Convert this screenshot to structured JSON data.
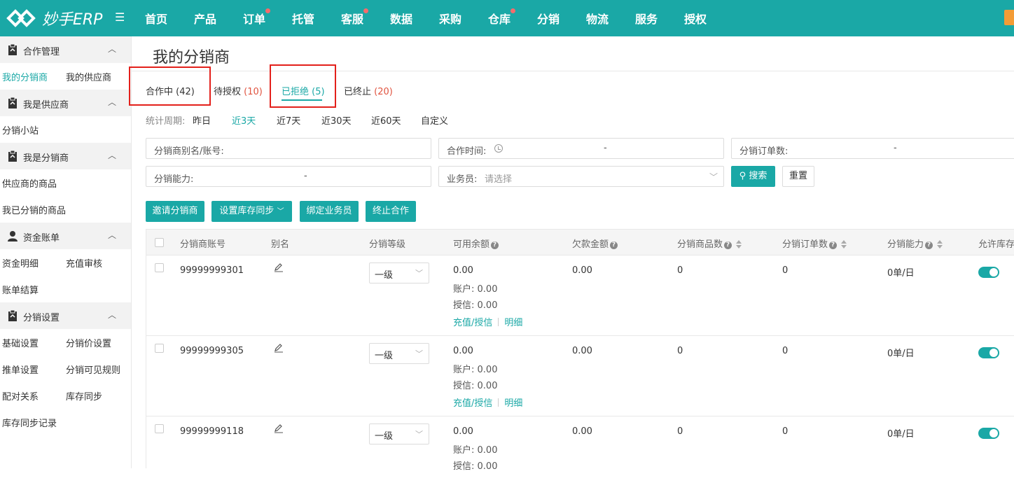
{
  "app": {
    "logo_text": "妙手ERP"
  },
  "nav": [
    "首页",
    "产品",
    "订单",
    "托管",
    "客服",
    "数据",
    "采购",
    "仓库",
    "分销",
    "物流",
    "服务",
    "授权"
  ],
  "sidebar": {
    "groups": [
      "合作管理",
      "我是供应商",
      "我是分销商",
      "资金账单",
      "分销设置"
    ],
    "links": {
      "my_distributors": "我的分销商",
      "my_suppliers": "我的供应商",
      "distribution_site": "分销小站",
      "supplier_products": "供应商的商品",
      "my_distributed_products": "我已分销的商品",
      "fund_details": "资金明细",
      "recharge_review": "充值审核",
      "bill_settlement": "账单结算",
      "basic_settings": "基础设置",
      "price_settings": "分销价设置",
      "push_settings": "推单设置",
      "visibility_rules": "分销可见规则",
      "pairing": "配对关系",
      "stock_sync": "库存同步",
      "stock_sync_log": "库存同步记录"
    }
  },
  "page": {
    "title": "我的分销商"
  },
  "tabs": [
    {
      "label": "合作中",
      "count": "(42)"
    },
    {
      "label": "待授权",
      "count": "(10)"
    },
    {
      "label": "已拒绝",
      "count": "(5)"
    },
    {
      "label": "已终止",
      "count": "(20)"
    }
  ],
  "period": {
    "label": "统计周期:",
    "options": [
      "昨日",
      "近3天",
      "近7天",
      "近30天",
      "近60天",
      "自定义"
    ],
    "selected": "近3天"
  },
  "filters": {
    "alias": "分销商别名/账号:",
    "coop_time": "合作时间:",
    "order_count": "分销订单数:",
    "capacity": "分销能力:",
    "salesperson": "业务员:",
    "salesperson_placeholder": "请选择",
    "dash": "-",
    "search": "搜索",
    "reset": "重置"
  },
  "actions": {
    "invite": "邀请分销商",
    "stock_sync": "设置库存同步",
    "bind_salesperson": "绑定业务员",
    "terminate": "终止合作"
  },
  "table": {
    "headers": [
      "分销商账号",
      "别名",
      "分销等级",
      "可用余额",
      "欠款金额",
      "分销商品数",
      "分销订单数",
      "分销能力",
      "允许库存"
    ],
    "account_label": "账户:",
    "credit_label": "授信:",
    "recharge_link": "充值/授信",
    "detail_link": "明细",
    "rows": [
      {
        "account": "99999999301",
        "level": "一级",
        "available": "0.00",
        "acct": "0.00",
        "credit": "0.00",
        "debt": "0.00",
        "products": "0",
        "orders": "0",
        "capacity": "0单/日",
        "allow_stock": true
      },
      {
        "account": "99999999305",
        "level": "一级",
        "available": "0.00",
        "acct": "0.00",
        "credit": "0.00",
        "debt": "0.00",
        "products": "0",
        "orders": "0",
        "capacity": "0单/日",
        "allow_stock": true
      },
      {
        "account": "99999999118",
        "level": "一级",
        "available": "0.00",
        "acct": "0.00",
        "credit": "0.00",
        "debt": "0.00",
        "products": "0",
        "orders": "0",
        "capacity": "0单/日",
        "allow_stock": true
      }
    ]
  },
  "colors": {
    "brand": "#1aa8a6",
    "highlight_box": "#e3201b",
    "badge": "#f56c6c",
    "count_red": "#e0533f"
  }
}
